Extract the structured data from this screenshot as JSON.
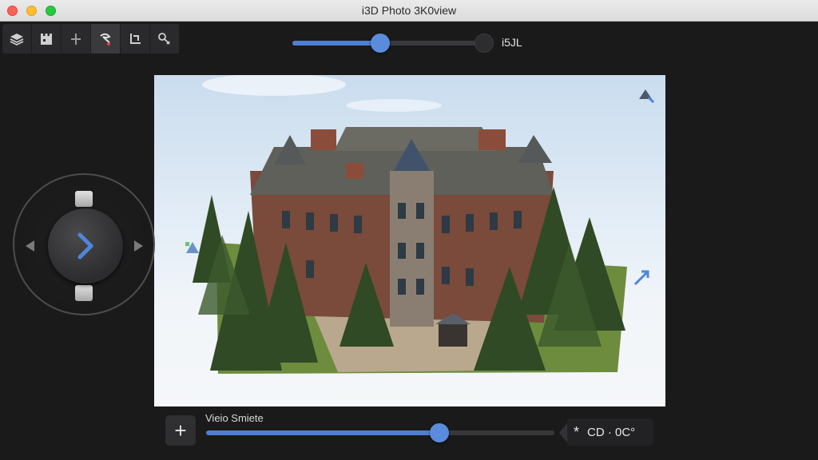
{
  "window": {
    "title": "i3D Photo 3K0view",
    "controls": [
      "close",
      "minimize",
      "zoom"
    ]
  },
  "toolbar": {
    "tools": [
      {
        "icon": "layers-icon"
      },
      {
        "icon": "scene-icon"
      },
      {
        "icon": "move-icon"
      },
      {
        "icon": "tour-icon",
        "active": true
      },
      {
        "icon": "crop-icon"
      },
      {
        "icon": "tag-icon"
      }
    ]
  },
  "top_slider": {
    "value_fraction": 0.46,
    "value_label": "i5JL"
  },
  "viewport": {
    "subject": "3d-mansion-model",
    "corner_icons": [
      "rotate-view-icon",
      "pan-left-icon",
      "expand-icon"
    ]
  },
  "joystick": {
    "center_icon": "chevron-right-icon",
    "directions": [
      "up",
      "down",
      "left",
      "right"
    ]
  },
  "bottom_bar": {
    "add_label": "+",
    "slider_label": "Vieio Smiete",
    "slider_value_fraction": 0.67,
    "value_icon": "asterisk-icon",
    "value_glyph": "*",
    "value_text": "CD · 0C°"
  },
  "colors": {
    "accent": "#5b8bdc",
    "background": "#1a1a1b",
    "titlebar": "#e2e2e2"
  }
}
